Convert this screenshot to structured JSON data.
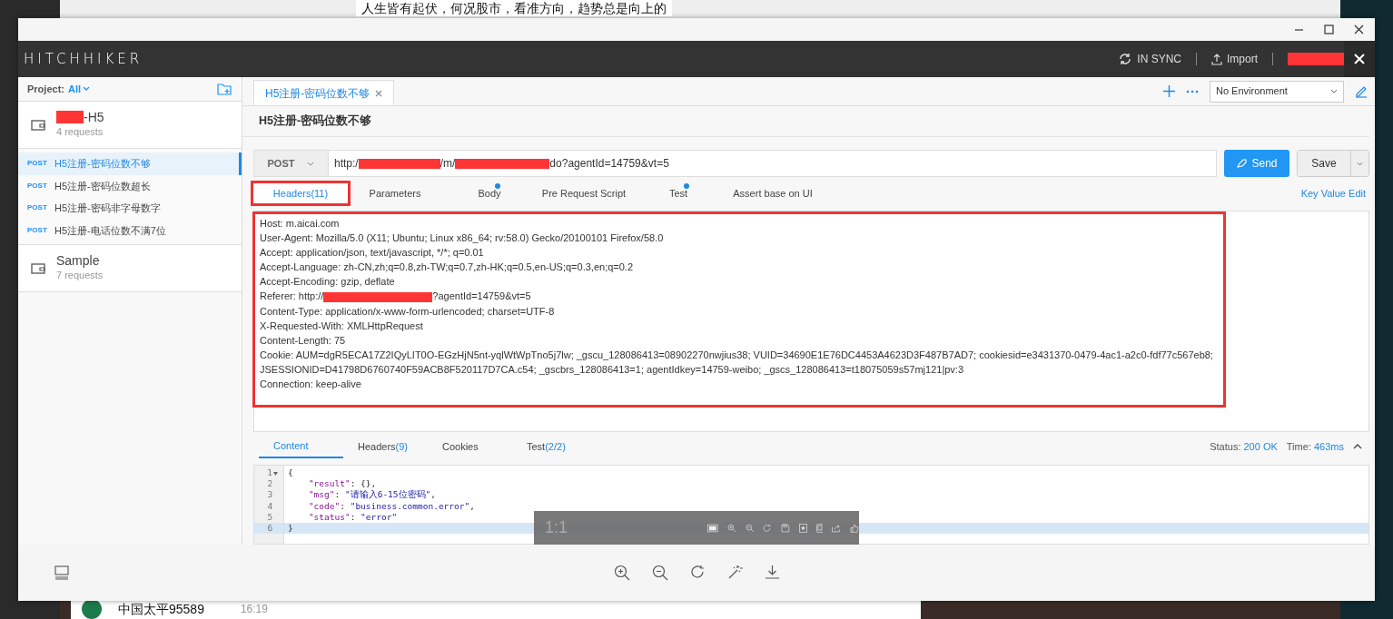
{
  "desktop": {
    "chat_message": "人生皆有起伏，何况股市，看准方向，趋势总是向上的",
    "contact": {
      "name": "中国太平95589",
      "time": "16:19"
    }
  },
  "app": {
    "logo": "HITCHHIKER",
    "sync": "IN SYNC",
    "import": "Import",
    "sidebar": {
      "project_label": "Project:",
      "project_value": "All",
      "collections": [
        {
          "name": "-H5",
          "redacted": true,
          "count": "4 requests",
          "requests": [
            {
              "method": "POST",
              "name": "H5注册-密码位数不够",
              "selected": true
            },
            {
              "method": "POST",
              "name": "H5注册-密码位数超长",
              "selected": false
            },
            {
              "method": "POST",
              "name": "H5注册-密码非字母数字",
              "selected": false
            },
            {
              "method": "POST",
              "name": "H5注册-电话位数不满7位",
              "selected": false
            }
          ]
        },
        {
          "name": "Sample",
          "redacted": false,
          "count": "7 requests"
        }
      ]
    },
    "open_tabs": [
      {
        "label": "H5注册-密码位数不够",
        "selected": true
      }
    ],
    "environment": "No Environment",
    "request": {
      "title": "H5注册-密码位数不够",
      "method": "POST",
      "url_parts": [
        "http:/",
        "/m/",
        "do?agentId=14759&vt=5"
      ],
      "send": "Send",
      "save": "Save",
      "tabs": [
        {
          "label": "Headers(11)",
          "selected": true,
          "dot": false,
          "annotated": true
        },
        {
          "label": "Parameters",
          "selected": false,
          "dot": false,
          "annotated": false
        },
        {
          "label": "Body",
          "selected": false,
          "dot": true,
          "annotated": false
        },
        {
          "label": "Pre Request Script",
          "selected": false,
          "dot": false,
          "annotated": false
        },
        {
          "label": "Test",
          "selected": false,
          "dot": true,
          "annotated": false
        },
        {
          "label": "Assert base on UI",
          "selected": false,
          "dot": false,
          "annotated": false
        }
      ],
      "key_value_edit": "Key Value Edit",
      "headers_annotated": true,
      "headers": [
        [
          "Host: m.aicai.com"
        ],
        [
          "User-Agent: Mozilla/5.0 (X11; Ubuntu; Linux x86_64; rv:58.0) Gecko/20100101 Firefox/58.0"
        ],
        [
          "Accept: application/json, text/javascript, */*; q=0.01"
        ],
        [
          "Accept-Language: zh-CN,zh;q=0.8,zh-TW;q=0.7,zh-HK;q=0.5,en-US;q=0.3,en;q=0.2"
        ],
        [
          "Accept-Encoding: gzip, deflate"
        ],
        [
          "Referer: http://",
          "?agentId=14759&vt=5"
        ],
        [
          "Content-Type: application/x-www-form-urlencoded; charset=UTF-8"
        ],
        [
          "X-Requested-With: XMLHttpRequest"
        ],
        [
          "Content-Length: 75"
        ],
        [
          "Cookie: AUM=dgR5ECA17Z2IQyLIT0O-EGzHjN5nt-yqlWtWpTno5j7lw; _gscu_128086413=08902270nwjius38; VUID=34690E1E76DC4453A4623D3F487B7AD7; cookiesid=e3431370-0479-4ac1-a2c0-fdf77c567eb8;"
        ],
        [
          "JSESSIONID=D41798D6760740F59ACB8F520117D7CA.c54; _gscbrs_128086413=1; agentIdkey=14759-weibo; _gscs_128086413=t18075059s57mj121|pv:3"
        ],
        [
          "Connection: keep-alive"
        ]
      ]
    },
    "response": {
      "tabs": [
        {
          "label": "Content",
          "selected": true
        },
        {
          "label": "Headers",
          "count": "(9)",
          "selected": false
        },
        {
          "label": "Cookies",
          "selected": false
        },
        {
          "label": "Test",
          "count": "(2/2)",
          "selected": false
        }
      ],
      "status_label": "Status:",
      "status": "200 OK",
      "time_label": "Time:",
      "time": "463ms",
      "code": [
        {
          "number": "1",
          "foldable": true,
          "active": false,
          "tokens": [
            {
              "text": "{",
              "kind": "punct"
            }
          ]
        },
        {
          "number": "2",
          "foldable": false,
          "active": false,
          "tokens": [
            {
              "text": "    \"result\"",
              "kind": "key"
            },
            {
              "text": ": {},",
              "kind": "punct"
            }
          ]
        },
        {
          "number": "3",
          "foldable": false,
          "active": false,
          "tokens": [
            {
              "text": "    \"msg\"",
              "kind": "key"
            },
            {
              "text": ": ",
              "kind": "punct"
            },
            {
              "text": "\"请输入6-15位密码\"",
              "kind": "string"
            },
            {
              "text": ",",
              "kind": "punct"
            }
          ]
        },
        {
          "number": "4",
          "foldable": false,
          "active": false,
          "tokens": [
            {
              "text": "    \"code\"",
              "kind": "key"
            },
            {
              "text": ": ",
              "kind": "punct"
            },
            {
              "text": "\"business.common.error\"",
              "kind": "string"
            },
            {
              "text": ",",
              "kind": "punct"
            }
          ]
        },
        {
          "number": "5",
          "foldable": false,
          "active": false,
          "tokens": [
            {
              "text": "    \"status\"",
              "kind": "key"
            },
            {
              "text": ": ",
              "kind": "punct"
            },
            {
              "text": "\"error\"",
              "kind": "string"
            }
          ]
        },
        {
          "number": "6",
          "foldable": false,
          "active": true,
          "tokens": [
            {
              "text": "}",
              "kind": "punct"
            }
          ]
        }
      ]
    }
  },
  "overlay_toolbar": {
    "ratio": "1:1"
  }
}
